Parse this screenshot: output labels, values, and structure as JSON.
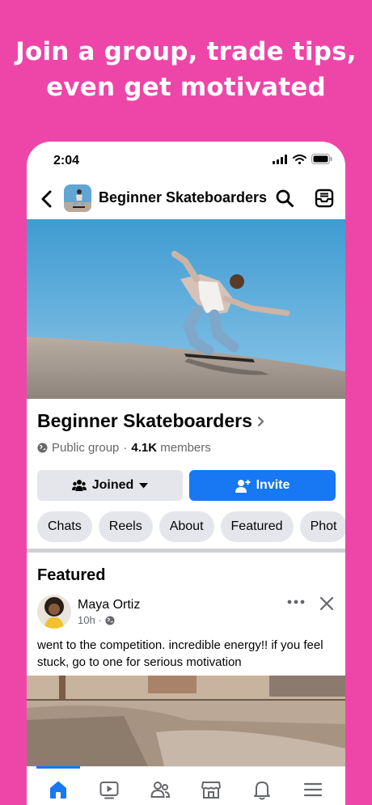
{
  "headline": {
    "line1": "Join a group, trade tips,",
    "line2": "even get motivated"
  },
  "status_bar": {
    "time": "2:04",
    "icons": [
      "signal-icon",
      "wifi-icon",
      "battery-icon"
    ]
  },
  "nav": {
    "title": "Beginner Skateboarders",
    "icons": [
      "back-arrow-icon",
      "search-icon",
      "inbox-icon"
    ]
  },
  "group": {
    "name": "Beginner Skateboarders",
    "privacy": "Public group",
    "separator": "·",
    "members_count": "4.1K",
    "members_label": "members"
  },
  "actions": {
    "joined_label": "Joined",
    "invite_label": "Invite"
  },
  "tabs": [
    "Chats",
    "Reels",
    "About",
    "Featured",
    "Phot"
  ],
  "featured": {
    "section_title": "Featured",
    "post": {
      "author": "Maya Ortiz",
      "time": "10h",
      "separator": "·",
      "text": "went to the competition. incredible energy!! if you feel stuck, go to one for serious motivation"
    }
  },
  "bottom_nav": {
    "items": [
      "home-icon",
      "video-icon",
      "groups-icon",
      "marketplace-icon",
      "notifications-icon",
      "menu-icon"
    ],
    "active": "home-icon"
  },
  "colors": {
    "background": "#EE46A8",
    "accent": "#1877F2",
    "button_gray": "#E4E6EB",
    "text": "#050505",
    "muted": "#65676B"
  }
}
